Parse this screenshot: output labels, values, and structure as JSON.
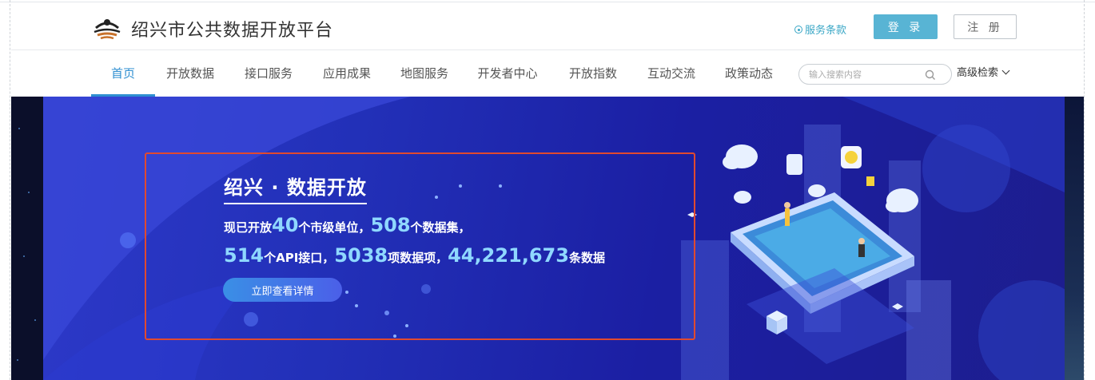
{
  "header": {
    "site_title": "绍兴市公共数据开放平台",
    "terms_label": "服务条款",
    "login_label": "登 录",
    "register_label": "注 册"
  },
  "nav": {
    "items": [
      "首页",
      "开放数据",
      "接口服务",
      "应用成果",
      "地图服务",
      "开发者中心",
      "开放指数",
      "互动交流",
      "政策动态"
    ],
    "active_index": 0,
    "search_placeholder": "输入搜索内容",
    "advanced_search_label": "高级检索"
  },
  "banner": {
    "title": "绍兴 · 数据开放",
    "line1": {
      "prefix": "现已开放",
      "units_count": "40",
      "units_label": "个市级单位，",
      "datasets_count": "508",
      "datasets_label": "个数据集，"
    },
    "line2": {
      "api_count": "514",
      "api_label": "个API接口，",
      "items_count": "5038",
      "items_label": "项数据项，",
      "records_count": "44,221,673",
      "records_label": "条数据"
    },
    "button_label": "立即查看详情"
  },
  "colors": {
    "accent": "#2f8fd1",
    "login_button": "#58b4d4",
    "highlight_border": "#e04a2f",
    "banner_bg": "#2230b8",
    "number_highlight": "#8fd8ff"
  }
}
